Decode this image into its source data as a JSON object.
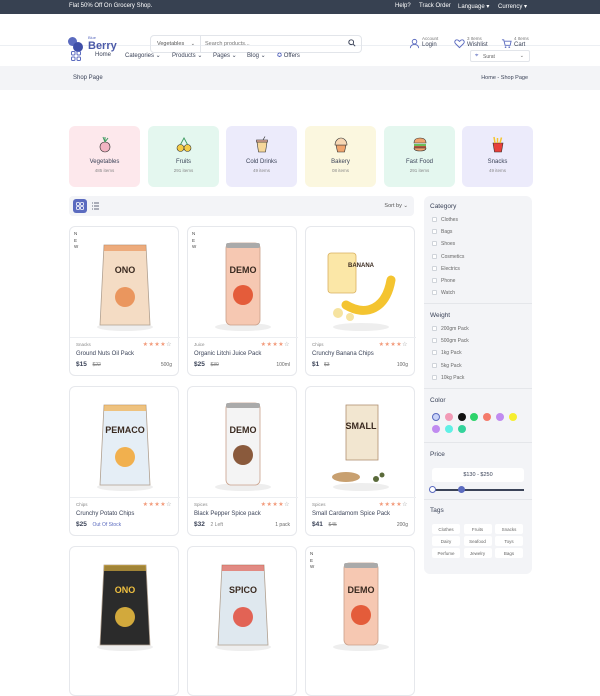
{
  "topbar": {
    "promo": "Flat 50% Off On Grocery Shop.",
    "links": [
      "Help?",
      "Track Order",
      "Language",
      "Currency"
    ]
  },
  "logo": {
    "small": "Blue",
    "big": "Berry"
  },
  "search": {
    "category": "Vegetables",
    "placeholder": "Search products..."
  },
  "header_icons": [
    {
      "label": "Account",
      "value": "Login",
      "icon": "user-icon"
    },
    {
      "label": "3 Items",
      "value": "Wishlist",
      "icon": "heart-icon"
    },
    {
      "label": "4 Items",
      "value": "Cart",
      "icon": "cart-icon"
    }
  ],
  "nav": {
    "items": [
      "Home",
      "Categories",
      "Products",
      "Pages",
      "Blog",
      "Offers"
    ],
    "location": "Surat"
  },
  "breadcrumb": {
    "title": "Shop Page",
    "home": "Home",
    "sep": "-",
    "current": "Shop Page"
  },
  "categories": [
    {
      "name": "Vegetables",
      "count": "485 items",
      "bg": "#fde8ec"
    },
    {
      "name": "Fruits",
      "count": "291 items",
      "bg": "#e4f7ef"
    },
    {
      "name": "Cold Drinks",
      "count": "49 items",
      "bg": "#ecebfb"
    },
    {
      "name": "Bakery",
      "count": "08 items",
      "bg": "#fbf7df"
    },
    {
      "name": "Fast Food",
      "count": "291 items",
      "bg": "#e4f7ef"
    },
    {
      "name": "Snacks",
      "count": "49 items",
      "bg": "#ecebfb"
    }
  ],
  "toolbar": {
    "sort_label": "Sort by"
  },
  "products": [
    {
      "category": "Snacks",
      "name": "Ground Nuts Oil Pack",
      "price": "$15",
      "old": "$22",
      "weight": "500g",
      "new": true,
      "stars": 4,
      "img": "ONO",
      "pkg": "#f4dcc4",
      "accent": "#e88a4c"
    },
    {
      "category": "Juice",
      "name": "Organic Litchi Juice Pack",
      "price": "$25",
      "old": "$30",
      "weight": "100ml",
      "new": true,
      "stars": 4,
      "img": "DEMO",
      "pkg": "#f6c8b2",
      "accent": "#e45c3a"
    },
    {
      "category": "Chips",
      "name": "Crunchy Banana Chips",
      "price": "$1",
      "old": "$3",
      "weight": "100g",
      "new": false,
      "stars": 4,
      "img": "BANANA",
      "pkg": "#fbe7a7",
      "accent": "#f4c430"
    },
    {
      "category": "Chips",
      "name": "Crunchy Potato Chips",
      "price": "$25",
      "old": "",
      "stock": "Out Of Stock",
      "weight": "",
      "new": false,
      "stars": 4,
      "img": "PEMACO",
      "pkg": "#e5eef6",
      "accent": "#f3a530"
    },
    {
      "category": "Spices",
      "name": "Black Pepper Spice pack",
      "price": "$32",
      "old": "",
      "stock": "2 Left",
      "weight": "1 pack",
      "new": false,
      "stars": 4,
      "img": "DEMO",
      "pkg": "#f4f4f4",
      "accent": "#8a5a3c"
    },
    {
      "category": "Spices",
      "name": "Small Cardamom Spice Pack",
      "price": "$41",
      "old": "$45",
      "weight": "200g",
      "new": false,
      "stars": 4,
      "img": "SMALL",
      "pkg": "#f2e6d0",
      "accent": "#4a3a2a"
    },
    {
      "new": false,
      "img": "ONO",
      "pkg": "#2b2b2b",
      "accent": "#f0c040"
    },
    {
      "new": false,
      "img": "SPICO",
      "pkg": "#dfe8ef",
      "accent": "#e34b3a"
    },
    {
      "new": true,
      "img": "DEMO",
      "pkg": "#f6c8b2",
      "accent": "#e45c3a"
    }
  ],
  "new_badge": "NEW",
  "sidebar": {
    "category_title": "Category",
    "category_items": [
      "Clothes",
      "Bags",
      "Shoes",
      "Cosmetics",
      "Electrics",
      "Phone",
      "Watch"
    ],
    "weight_title": "Weight",
    "weight_items": [
      "200gm Pack",
      "500gm Pack",
      "1kg Pack",
      "5kg Pack",
      "10kg Pack"
    ],
    "color_title": "Color",
    "colors": [
      "#c9d3f8",
      "#f29ab6",
      "#111111",
      "#2ed36b",
      "#f47b6b",
      "#c08bf0",
      "#f6ee30",
      "#c08bf0",
      "#60f0e6",
      "#33d39b"
    ],
    "price_title": "Price",
    "price_range": "$130 - $250",
    "tags_title": "Tags",
    "tags": [
      "Clothes",
      "Fruits",
      "Snacks",
      "Dairy",
      "Seafood",
      "Toys",
      "Perfume",
      "Jewelry",
      "Bags"
    ]
  }
}
